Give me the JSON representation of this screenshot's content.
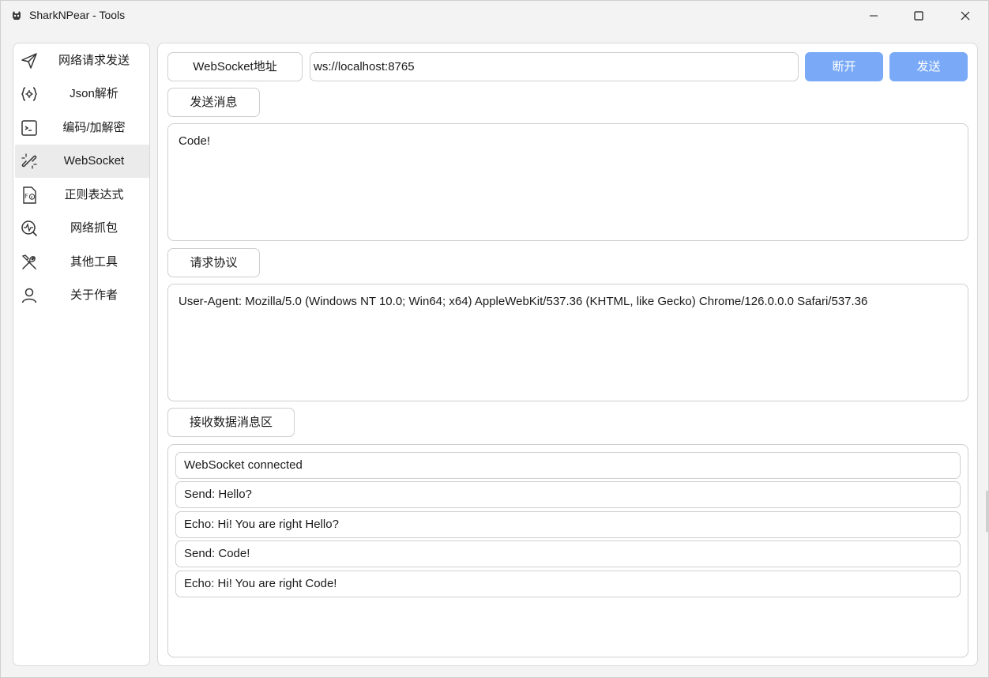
{
  "window": {
    "title": "SharkNPear - Tools",
    "controls": [
      "minimize-icon",
      "maximize-icon",
      "close-icon"
    ]
  },
  "sidebar": {
    "items": [
      {
        "label": "网络请求发送",
        "icon": "send-icon",
        "active": false
      },
      {
        "label": "Json解析",
        "icon": "json-braces-icon",
        "active": false
      },
      {
        "label": "编码/加解密",
        "icon": "terminal-icon",
        "active": false
      },
      {
        "label": "WebSocket",
        "icon": "link-broken-icon",
        "active": true
      },
      {
        "label": "正则表达式",
        "icon": "formula-file-icon",
        "active": false
      },
      {
        "label": "网络抓包",
        "icon": "pulse-search-icon",
        "active": false
      },
      {
        "label": "其他工具",
        "icon": "wrench-screwdriver-icon",
        "active": false
      },
      {
        "label": "关于作者",
        "icon": "person-icon",
        "active": false
      }
    ]
  },
  "main": {
    "url_label": "WebSocket地址",
    "url_value": "ws://localhost:8765",
    "disconnect_label": "断开",
    "send_label": "发送",
    "message_label": "发送消息",
    "message_value": "Code!",
    "protocol_label": "请求协议",
    "protocol_value": "User-Agent: Mozilla/5.0 (Windows NT 10.0; Win64; x64) AppleWebKit/537.36 (KHTML, like Gecko) Chrome/126.0.0.0 Safari/537.36",
    "received_label": "接收数据消息区",
    "received_messages": [
      "WebSocket connected",
      "Send: Hello?",
      "Echo: Hi!  You are right Hello?",
      "Send: Code!",
      "Echo: Hi!  You are right Code!"
    ]
  },
  "colors": {
    "accent": "#7aaaf7",
    "active_nav": "#ebebeb",
    "border": "#cfcfcf",
    "background": "#f3f3f3"
  }
}
